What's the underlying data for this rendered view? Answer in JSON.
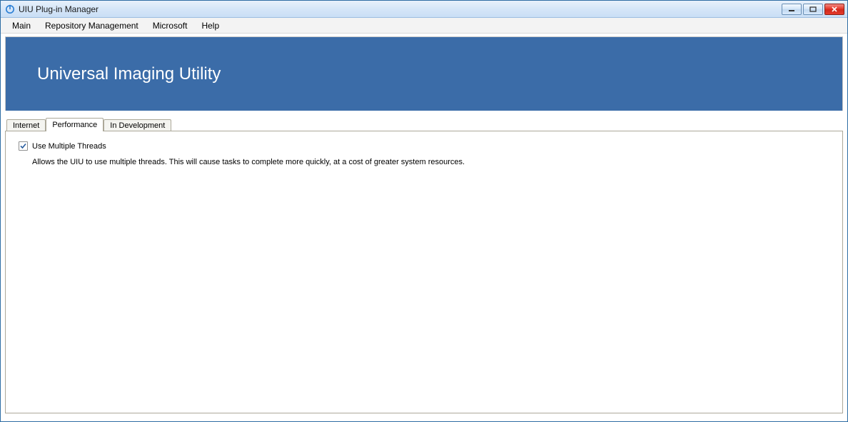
{
  "window": {
    "title": "UIU Plug-in Manager"
  },
  "menubar": {
    "items": [
      "Main",
      "Repository Management",
      "Microsoft",
      "Help"
    ]
  },
  "banner": {
    "title": "Universal Imaging Utility"
  },
  "tabs": {
    "items": [
      "Internet",
      "Performance",
      "In Development"
    ],
    "active_index": 1
  },
  "panel": {
    "checkbox_label": "Use Multiple Threads",
    "checkbox_checked": true,
    "description": "Allows the UIU to use multiple threads. This will cause tasks to complete more quickly, at a cost of greater system resources."
  }
}
